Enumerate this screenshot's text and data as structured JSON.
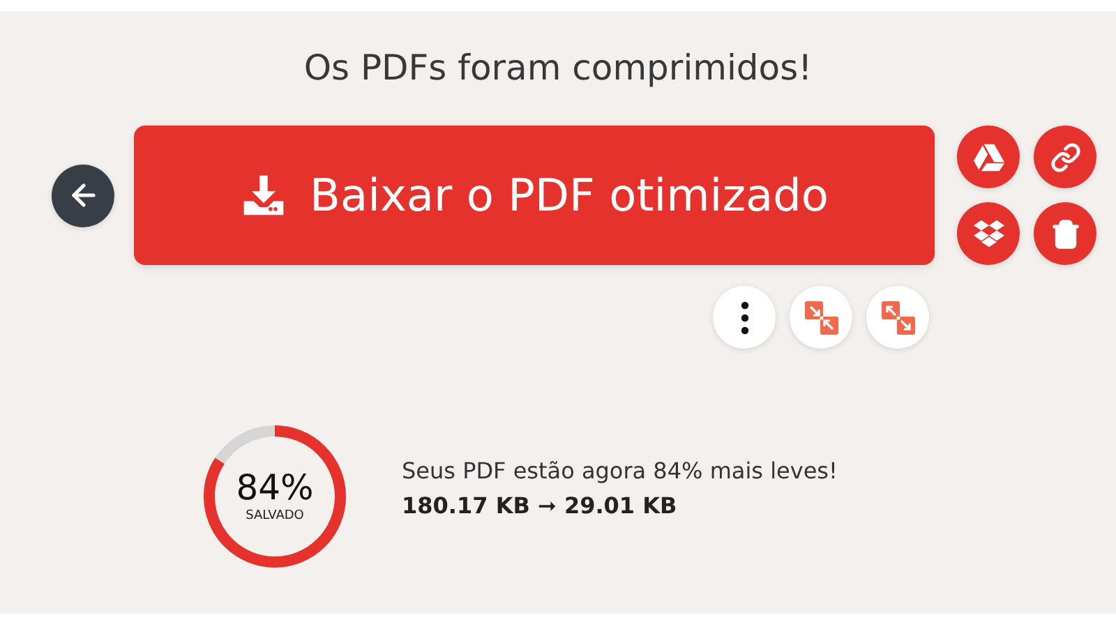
{
  "title": "Os PDFs foram comprimidos!",
  "download_button": {
    "label": "Baixar o PDF otimizado"
  },
  "savings": {
    "percent": "84%",
    "caption": "SALVADO",
    "message": "Seus PDF estão agora 84% mais leves!",
    "sizes": "180.17 KB ➞ 29.01 KB"
  }
}
